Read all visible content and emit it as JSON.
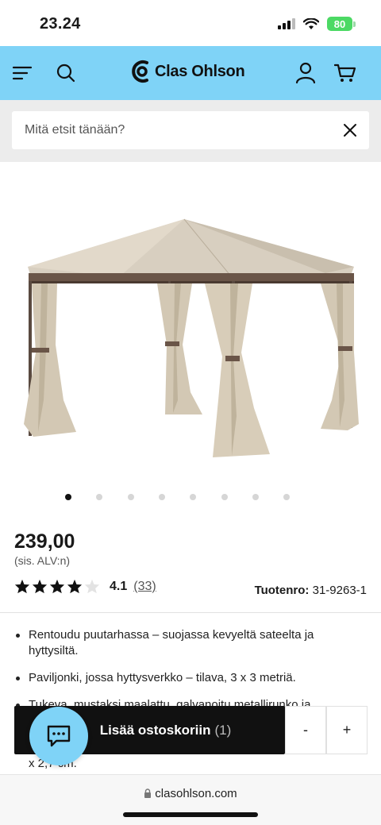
{
  "status_bar": {
    "time": "23.24",
    "battery": "80"
  },
  "header": {
    "brand": "Clas Ohlson",
    "icons": [
      "menu-icon",
      "search-icon",
      "account-icon",
      "cart-icon"
    ],
    "background_color": "#7fd3f7"
  },
  "search": {
    "placeholder": "Mitä etsit tänään?"
  },
  "product": {
    "image_alt": "",
    "price": "239,00",
    "vat_note": "(sis. ALV:n)",
    "rating": {
      "value": "4.1",
      "stars": 4,
      "reviews": "(33)"
    },
    "product_number_label": "Tuotenro:",
    "product_number": "31-9263-1",
    "features": [
      "Rentoudu puutarhassa – suojassa kevyeltä sateelta ja hyttysiltä.",
      "Paviljonki, jossa hyttysverkko – tilava, 3 x 3 metriä.",
      "Tukeva, mustaksi maalattu, galvanoitu metallirunko ja"
    ],
    "partial_text": "x 2,7 cm."
  },
  "carousel": {
    "active_index": 0,
    "count": 8
  },
  "cart": {
    "add_label": "Lisää ostoskoriin",
    "count": "(1)",
    "decrease": "-",
    "increase": "+"
  },
  "browser": {
    "url": "clasohlson.com"
  }
}
